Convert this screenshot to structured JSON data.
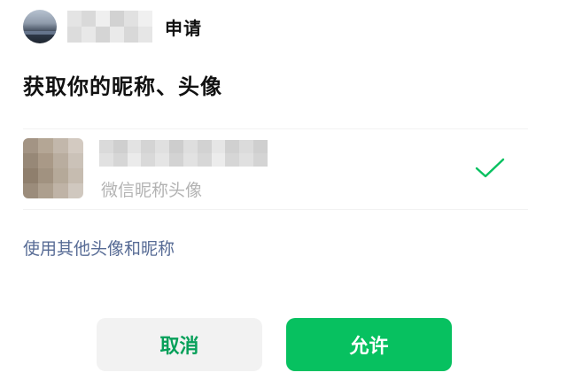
{
  "header": {
    "app_avatar_icon": "app-avatar-image",
    "app_name_mosaic_colors": [
      "#e4e4e4",
      "#d9d9d9",
      "#efefef",
      "#d2d2d2",
      "#e1e1e1",
      "#f0f0f0",
      "#dcdcdc",
      "#e8e8e8",
      "#d5d5d5",
      "#eaeaea",
      "#d8d8d8",
      "#e6e6e6"
    ],
    "apply_text": "申请"
  },
  "title": "获取你的昵称、头像",
  "profile_option": {
    "avatar_mosaic_colors": [
      "#a39484",
      "#b4a695",
      "#c2b7ab",
      "#d3cac1",
      "#978877",
      "#a99987",
      "#b9ad9f",
      "#cbc2b8",
      "#8f7f6d",
      "#a19280",
      "#b5a999",
      "#c6bcb0",
      "#9b8c7b",
      "#ad9f8e",
      "#bfb3a6",
      "#d0c8bf"
    ],
    "nickname_mosaic_colors": [
      "#dadada",
      "#cfcfcf",
      "#e3e3e3",
      "#d4d4d4",
      "#e0e0e0",
      "#cdcdcd",
      "#dedede",
      "#d2d2d2",
      "#e6e6e6",
      "#d0d0d0",
      "#dbdbdb",
      "#cfcfcf",
      "#e1e1e1",
      "#d6d6d6",
      "#ebebeb",
      "#d9d9d9",
      "#e5e5e5",
      "#d3d3d3",
      "#e2e2e2",
      "#d7d7d7",
      "#ececec",
      "#d6d6d6",
      "#e0e0e0",
      "#d4d4d4"
    ],
    "caption": "微信昵称头像",
    "selected_icon": "checkmark-icon",
    "selected_color": "#07c160"
  },
  "use_other_label": "使用其他头像和昵称",
  "buttons": {
    "cancel_label": "取消",
    "allow_label": "允许"
  },
  "colors": {
    "primary_green": "#07c160",
    "link_blue": "#576b95",
    "cancel_bg": "#f2f2f2"
  }
}
